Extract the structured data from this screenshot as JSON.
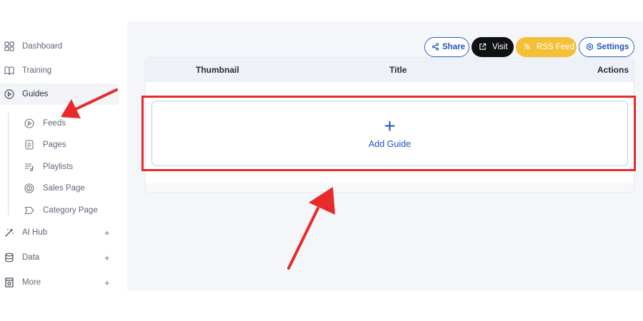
{
  "sidebar": {
    "items": [
      {
        "label": "Dashboard",
        "icon": "grid-icon"
      },
      {
        "label": "Training",
        "icon": "book-icon"
      },
      {
        "label": "Guides",
        "icon": "play-circle-icon",
        "active": true
      }
    ],
    "sub_items": [
      {
        "label": "Feeds",
        "icon": "play-circle-icon"
      },
      {
        "label": "Pages",
        "icon": "document-icon"
      },
      {
        "label": "Playlists",
        "icon": "playlist-icon"
      },
      {
        "label": "Sales Page",
        "icon": "dollar-badge-icon"
      },
      {
        "label": "Category Page",
        "icon": "tag-icon"
      }
    ],
    "expandable": [
      {
        "label": "AI Hub",
        "icon": "magic-wand-icon",
        "toggle": "+"
      },
      {
        "label": "Data",
        "icon": "database-icon",
        "toggle": "+"
      },
      {
        "label": "More",
        "icon": "store-icon",
        "toggle": "+"
      }
    ]
  },
  "toolbar": {
    "share_label": "Share",
    "visit_label": "Visit",
    "rss_label": "RSS Feed",
    "settings_label": "Settings"
  },
  "table": {
    "columns": [
      "Thumbnail",
      "Title",
      "Actions"
    ]
  },
  "add_guide": {
    "plus": "+",
    "label": "Add Guide"
  },
  "colors": {
    "accent": "#2452c4",
    "rss": "#f4c038",
    "visit": "#101114",
    "annotation": "#e82a2a"
  }
}
